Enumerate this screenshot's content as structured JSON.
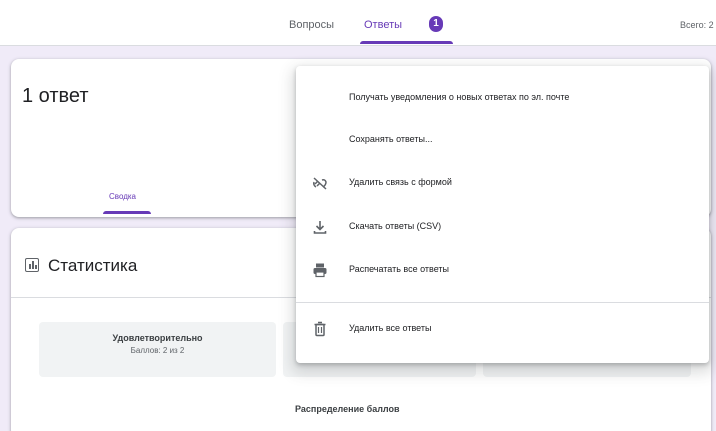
{
  "header": {
    "tabs": [
      {
        "label": "Вопросы"
      },
      {
        "label": "Ответы",
        "badge": "1"
      }
    ],
    "total": "Всего: 2"
  },
  "responses": {
    "count_text": "1 ответ",
    "summary_tab": "Сводка"
  },
  "stats": {
    "title": "Статистика",
    "boxes": [
      {
        "title": "Удовлетворительно",
        "sub": "Баллов: 2 из 2"
      }
    ],
    "distribution_label": "Распределение баллов"
  },
  "menu": {
    "items": [
      {
        "label": "Получать уведомления о новых ответах по эл. почте",
        "icon": "none"
      },
      {
        "label": "Сохранять ответы...",
        "icon": "none"
      },
      {
        "label": "Удалить связь с формой",
        "icon": "unlink-icon"
      },
      {
        "label": "Скачать ответы (CSV)",
        "icon": "download-icon"
      },
      {
        "label": "Распечатать все ответы",
        "icon": "print-icon"
      },
      {
        "label": "Удалить все ответы",
        "icon": "trash-icon"
      }
    ]
  },
  "colors": {
    "accent": "#673ab7",
    "background": "#f0ebf8"
  }
}
